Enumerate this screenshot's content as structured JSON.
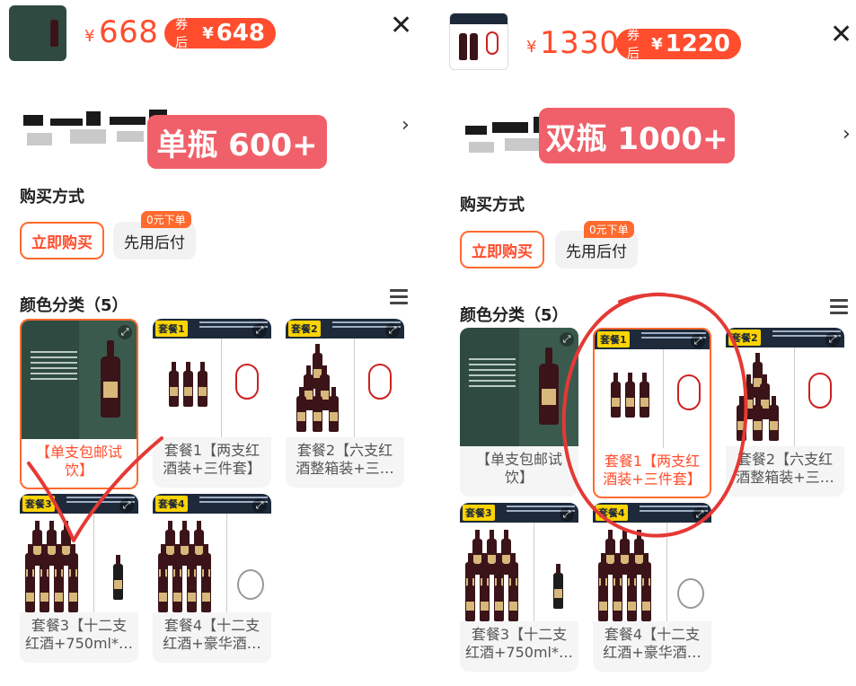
{
  "left": {
    "price_symbol": "¥",
    "price": "668",
    "coupon_label": "券后",
    "coupon_symbol": "¥",
    "coupon_price": "648",
    "close_glyph": "✕",
    "overlay_tag": "单瓶 600+",
    "chevron_glyph": "›",
    "buy_method_title": "购买方式",
    "buy_now_label": "立即购买",
    "pay_later_label": "先用后付",
    "zero_badge": "0元下单",
    "category_title": "颜色分类（5）",
    "cards": [
      {
        "caption": "【单支包邮试饮】",
        "selected": true
      },
      {
        "caption": "套餐1【两支红酒装+三件套】",
        "selected": false,
        "tag": "套餐1"
      },
      {
        "caption": "套餐2【六支红酒整箱装+三…",
        "selected": false,
        "tag": "套餐2"
      },
      {
        "caption": "套餐3【十二支红酒+750ml*…",
        "selected": false,
        "tag": "套餐3"
      },
      {
        "caption": "套餐4【十二支红酒+豪华酒…",
        "selected": false,
        "tag": "套餐4"
      }
    ],
    "annotation_color": "#e53935"
  },
  "right": {
    "price_symbol": "¥",
    "price": "1330",
    "coupon_label": "券后",
    "coupon_symbol": "¥",
    "coupon_price": "1220",
    "close_glyph": "✕",
    "overlay_tag": "双瓶 1000+",
    "chevron_glyph": "›",
    "buy_method_title": "购买方式",
    "buy_now_label": "立即购买",
    "pay_later_label": "先用后付",
    "zero_badge": "0元下单",
    "category_title": "颜色分类（5）",
    "cards": [
      {
        "caption": "【单支包邮试饮】",
        "selected": false
      },
      {
        "caption": "套餐1【两支红酒装+三件套】",
        "selected": true,
        "tag": "套餐1"
      },
      {
        "caption": "套餐2【六支红酒整箱装+三…",
        "selected": false,
        "tag": "套餐2"
      },
      {
        "caption": "套餐3【十二支红酒+750ml*…",
        "selected": false,
        "tag": "套餐3"
      },
      {
        "caption": "套餐4【十二支红酒+豪华酒…",
        "selected": false,
        "tag": "套餐4"
      }
    ],
    "annotation_color": "#e53935"
  },
  "colors": {
    "accent": "#ff4d2d",
    "coupon_bg": "#ff4d2d",
    "overlay_tag_bg": "#f0606a",
    "thumb_green": "#2f4a40"
  }
}
